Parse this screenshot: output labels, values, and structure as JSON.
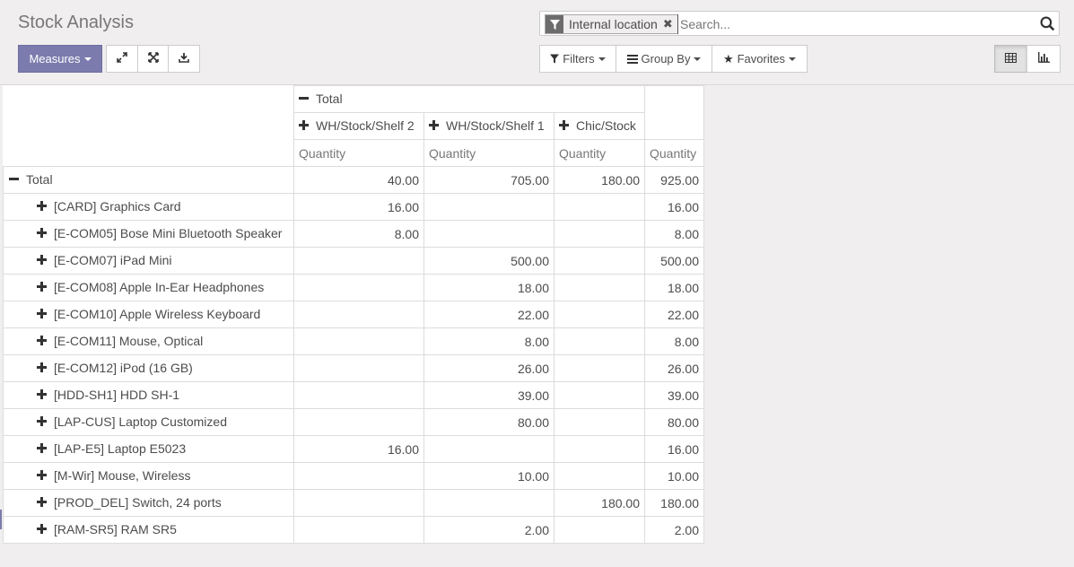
{
  "title": "Stock Analysis",
  "search": {
    "facet_label": "Internal location",
    "placeholder": "Search..."
  },
  "toolbar": {
    "measures_label": "Measures",
    "filters_label": "Filters",
    "groupby_label": "Group By",
    "favorites_label": "Favorites"
  },
  "colors": {
    "primary": "#7c7bad",
    "background": "#f0eeee"
  },
  "pivot": {
    "col_total_label": "Total",
    "columns": [
      "WH/Stock/Shelf 2",
      "WH/Stock/Shelf 1",
      "Chic/Stock"
    ],
    "measure": "Quantity",
    "total_row": {
      "label": "Total",
      "values": [
        "40.00",
        "705.00",
        "180.00"
      ],
      "total": "925.00"
    },
    "rows": [
      {
        "label": "[CARD] Graphics Card",
        "values": [
          "16.00",
          "",
          ""
        ],
        "total": "16.00"
      },
      {
        "label": "[E-COM05] Bose Mini Bluetooth Speaker",
        "values": [
          "8.00",
          "",
          ""
        ],
        "total": "8.00"
      },
      {
        "label": "[E-COM07] iPad Mini",
        "values": [
          "",
          "500.00",
          ""
        ],
        "total": "500.00"
      },
      {
        "label": "[E-COM08] Apple In-Ear Headphones",
        "values": [
          "",
          "18.00",
          ""
        ],
        "total": "18.00"
      },
      {
        "label": "[E-COM10] Apple Wireless Keyboard",
        "values": [
          "",
          "22.00",
          ""
        ],
        "total": "22.00"
      },
      {
        "label": "[E-COM11] Mouse, Optical",
        "values": [
          "",
          "8.00",
          ""
        ],
        "total": "8.00"
      },
      {
        "label": "[E-COM12] iPod (16 GB)",
        "values": [
          "",
          "26.00",
          ""
        ],
        "total": "26.00"
      },
      {
        "label": "[HDD-SH1] HDD SH-1",
        "values": [
          "",
          "39.00",
          ""
        ],
        "total": "39.00"
      },
      {
        "label": "[LAP-CUS] Laptop Customized",
        "values": [
          "",
          "80.00",
          ""
        ],
        "total": "80.00"
      },
      {
        "label": "[LAP-E5] Laptop E5023",
        "values": [
          "16.00",
          "",
          ""
        ],
        "total": "16.00"
      },
      {
        "label": "[M-Wir] Mouse, Wireless",
        "values": [
          "",
          "10.00",
          ""
        ],
        "total": "10.00"
      },
      {
        "label": "[PROD_DEL] Switch, 24 ports",
        "values": [
          "",
          "",
          "180.00"
        ],
        "total": "180.00"
      },
      {
        "label": "[RAM-SR5] RAM SR5",
        "values": [
          "",
          "2.00",
          ""
        ],
        "total": "2.00"
      }
    ]
  }
}
